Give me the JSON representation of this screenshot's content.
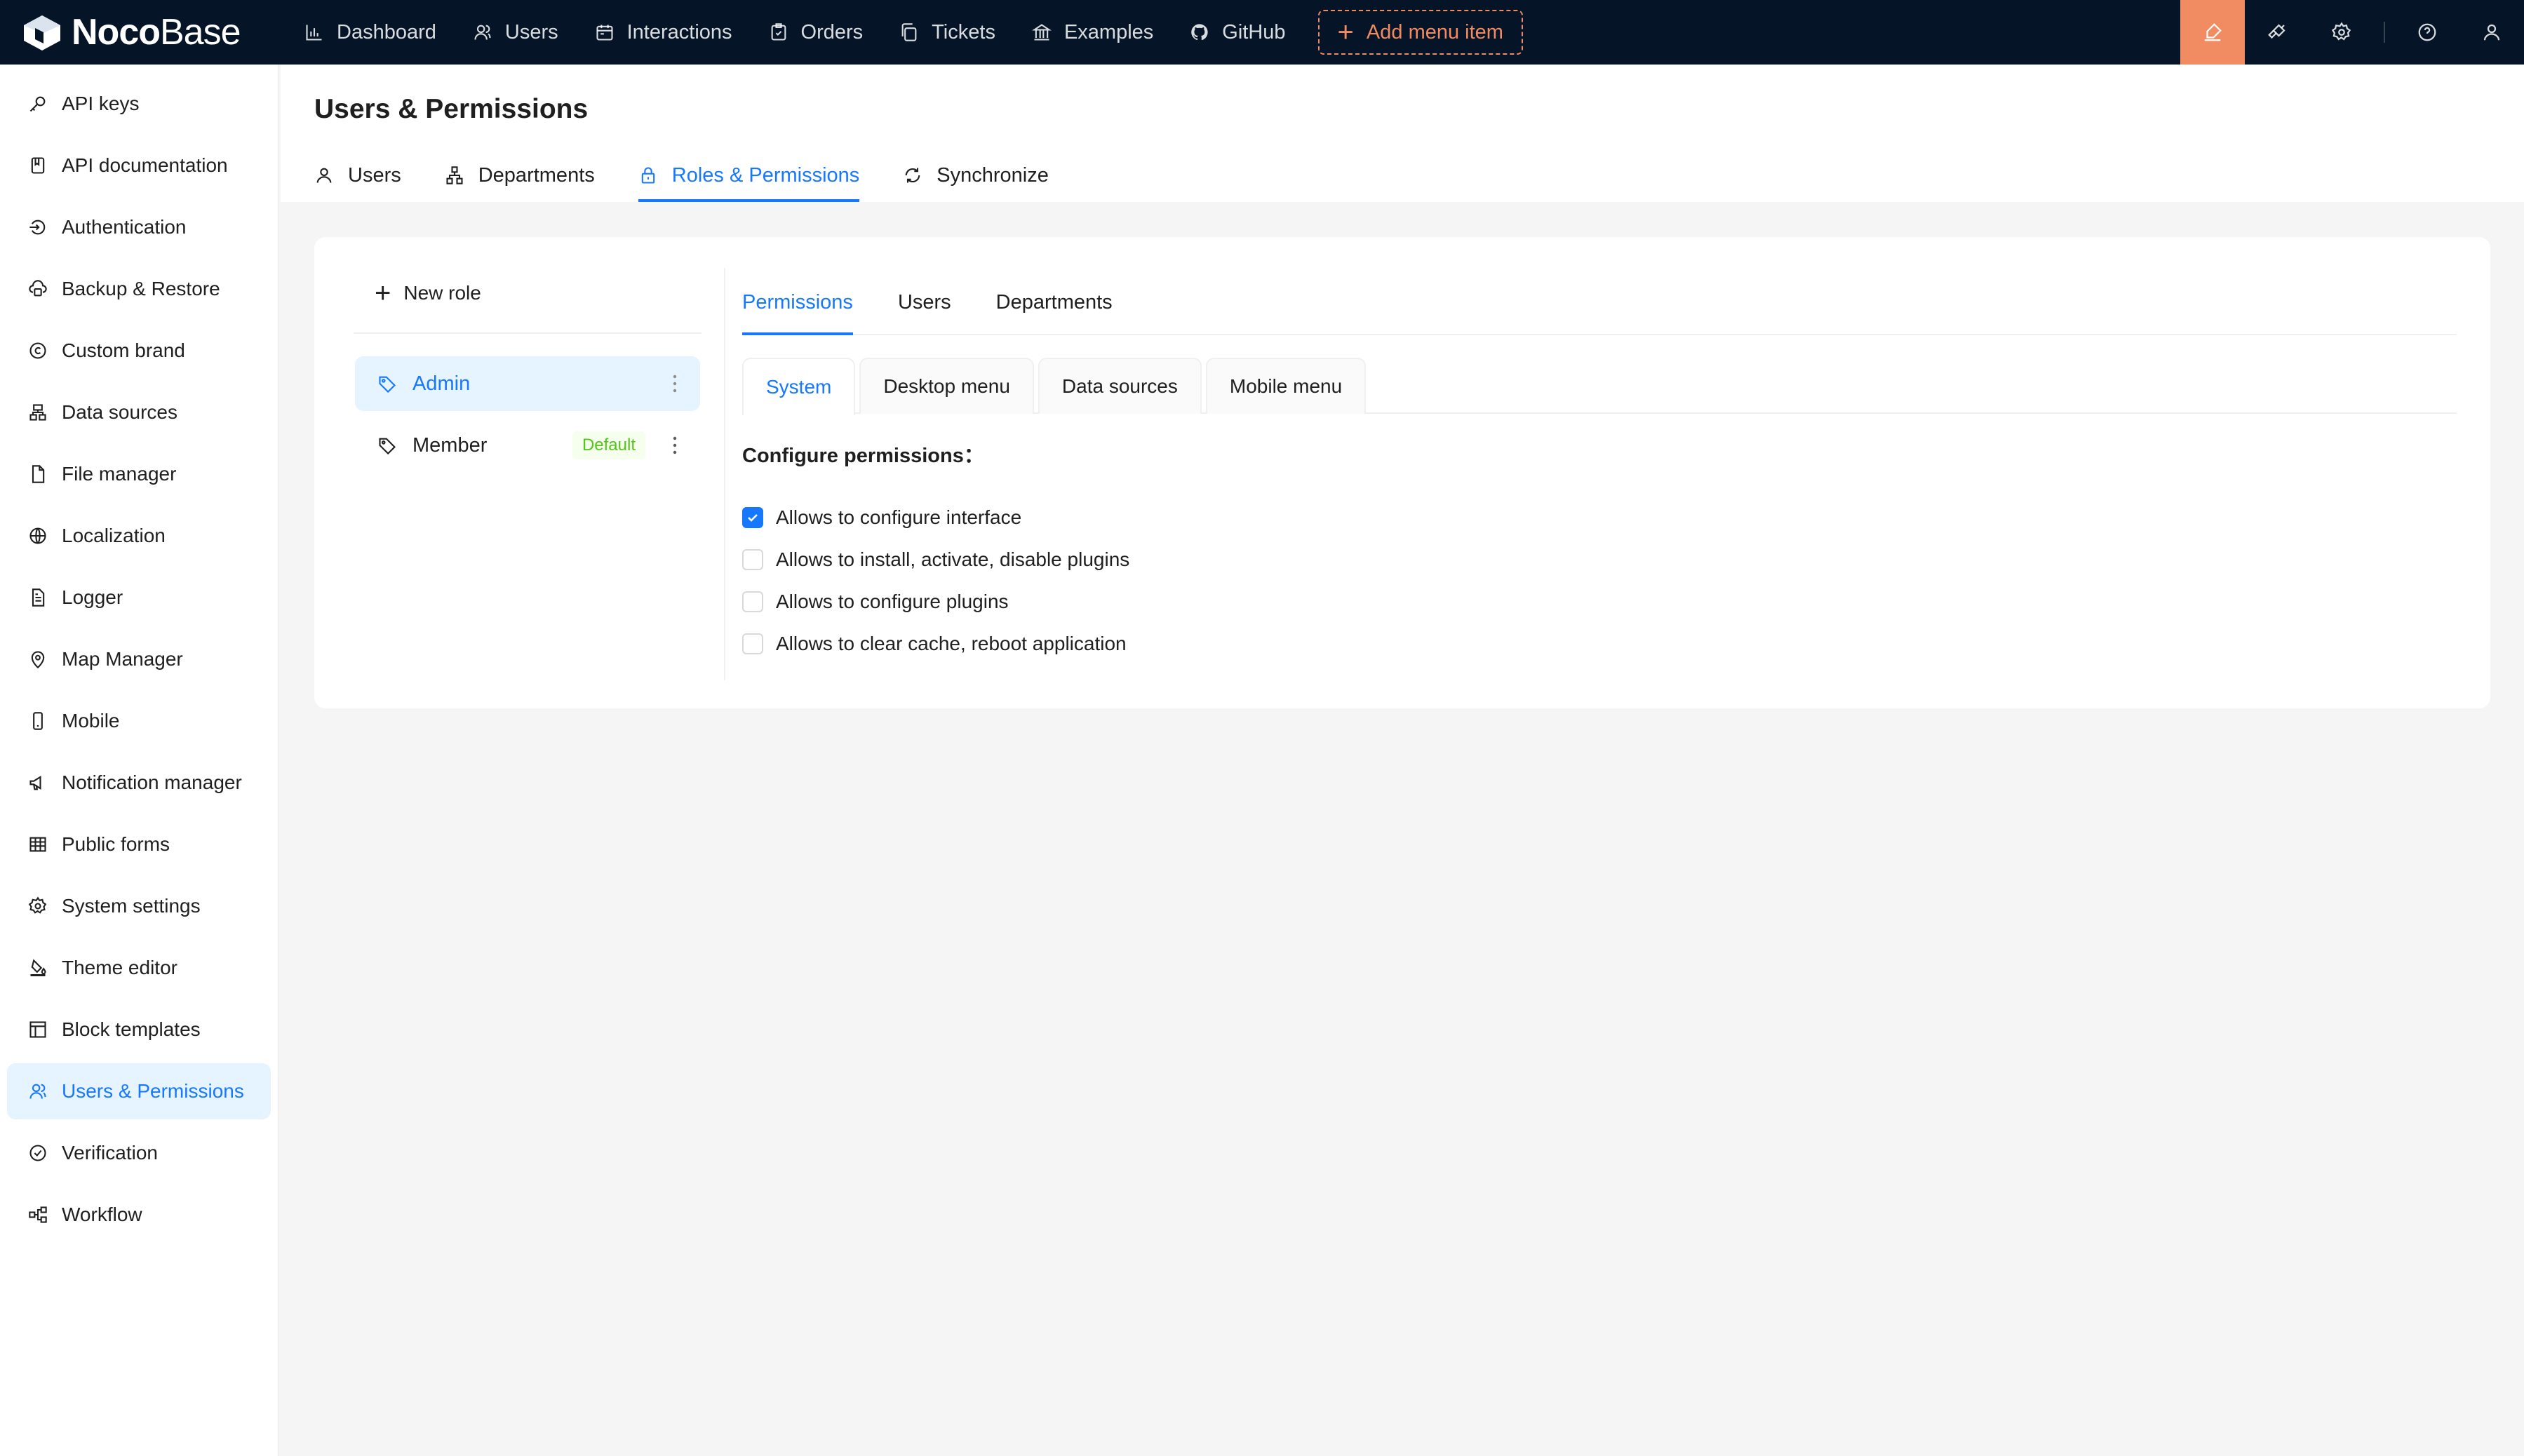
{
  "topbar": {
    "logo_bold": "Noco",
    "logo_light": "Base",
    "nav": [
      {
        "label": "Dashboard",
        "icon": "bar-chart-icon"
      },
      {
        "label": "Users",
        "icon": "users-icon"
      },
      {
        "label": "Interactions",
        "icon": "calendar-icon"
      },
      {
        "label": "Orders",
        "icon": "clipboard-icon"
      },
      {
        "label": "Tickets",
        "icon": "copy-icon"
      },
      {
        "label": "Examples",
        "icon": "bank-icon"
      },
      {
        "label": "GitHub",
        "icon": "github-icon"
      }
    ],
    "add_menu_label": "Add menu item",
    "right_icons": [
      "highlight-icon",
      "plugin-icon",
      "settings-icon",
      "help-icon",
      "user-icon"
    ],
    "accent_color": "#f18b62",
    "background_color": "#051426"
  },
  "sidebar": {
    "active_color": "#1677ff",
    "items": [
      {
        "label": "API keys",
        "icon": "key-icon"
      },
      {
        "label": "API documentation",
        "icon": "document-icon"
      },
      {
        "label": "Authentication",
        "icon": "login-icon"
      },
      {
        "label": "Backup & Restore",
        "icon": "cloud-server-icon"
      },
      {
        "label": "Custom brand",
        "icon": "copyright-icon"
      },
      {
        "label": "Data sources",
        "icon": "cluster-icon"
      },
      {
        "label": "File manager",
        "icon": "file-icon"
      },
      {
        "label": "Localization",
        "icon": "globe-icon"
      },
      {
        "label": "Logger",
        "icon": "file-text-icon"
      },
      {
        "label": "Map Manager",
        "icon": "map-pin-icon"
      },
      {
        "label": "Mobile",
        "icon": "mobile-icon"
      },
      {
        "label": "Notification manager",
        "icon": "notification-icon"
      },
      {
        "label": "Public forms",
        "icon": "table-icon"
      },
      {
        "label": "System settings",
        "icon": "gear-icon"
      },
      {
        "label": "Theme editor",
        "icon": "bg-colors-icon"
      },
      {
        "label": "Block templates",
        "icon": "layout-icon"
      },
      {
        "label": "Users & Permissions",
        "icon": "user-permissions-icon",
        "active": true
      },
      {
        "label": "Verification",
        "icon": "check-circle-icon"
      },
      {
        "label": "Workflow",
        "icon": "workflow-icon"
      }
    ]
  },
  "page": {
    "title": "Users & Permissions",
    "tabs": [
      {
        "label": "Users",
        "icon": "user-icon"
      },
      {
        "label": "Departments",
        "icon": "apartment-icon"
      },
      {
        "label": "Roles & Permissions",
        "icon": "lock-icon",
        "active": true
      },
      {
        "label": "Synchronize",
        "icon": "sync-icon"
      }
    ]
  },
  "roles": {
    "new_role_label": "New role",
    "items": [
      {
        "label": "Admin",
        "active": true
      },
      {
        "label": "Member",
        "badge": "Default",
        "badge_color": "#52c41a"
      }
    ]
  },
  "permissions": {
    "tabs": [
      "Permissions",
      "Users",
      "Departments"
    ],
    "active_tab": "Permissions",
    "sub_tabs": [
      "System",
      "Desktop menu",
      "Data sources",
      "Mobile menu"
    ],
    "active_sub_tab": "System",
    "configure_label": "Configure permissions：",
    "options": [
      {
        "label": "Allows to configure interface",
        "checked": true
      },
      {
        "label": "Allows to install, activate, disable plugins",
        "checked": false
      },
      {
        "label": "Allows to configure plugins",
        "checked": false
      },
      {
        "label": "Allows to clear cache, reboot application",
        "checked": false
      }
    ]
  }
}
